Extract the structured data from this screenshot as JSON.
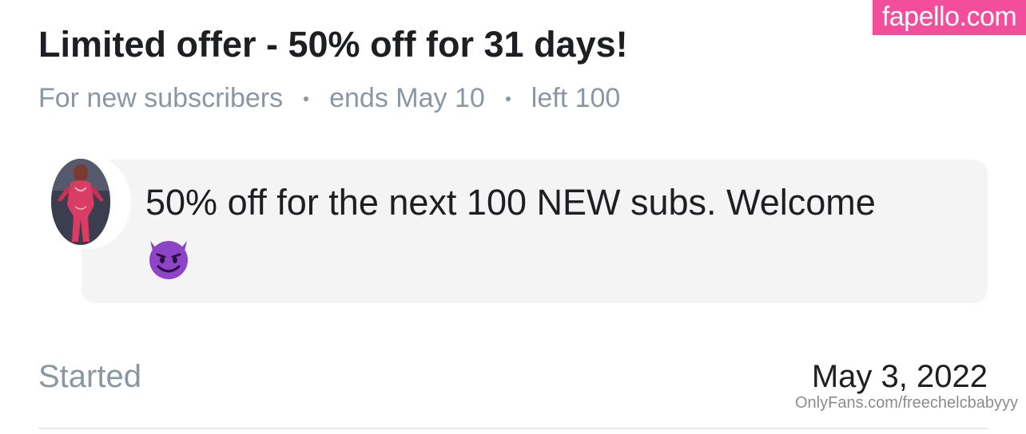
{
  "watermark": {
    "top_label": "fapello.com",
    "bottom_label": "OnlyFans.com/freechelcbabyyy"
  },
  "offer": {
    "title": "Limited offer - 50% off for 31 days!",
    "audience": "For new subscribers",
    "ends": "ends May 10",
    "left": "left 100"
  },
  "message": {
    "text": "50% off for the next 100 NEW subs. Welcome",
    "emoji": "smiling-devil-emoji"
  },
  "details": {
    "started_label": "Started",
    "started_value": "May 3, 2022"
  },
  "colors": {
    "watermark_bg": "#f34e9b",
    "muted_text": "#8a96a3",
    "primary_text": "#1d1f22",
    "bubble_bg": "#f4f4f4",
    "emoji_purple": "#8e44c9"
  }
}
